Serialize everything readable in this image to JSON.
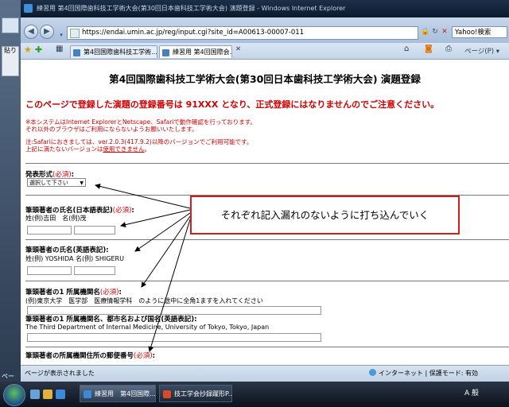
{
  "desktop": {
    "left_icon_label": "貼り",
    "bottom_label": "ペー"
  },
  "window": {
    "title": "練習用 第4回国際歯科技工学術大会(第30回日本歯科技工学術大会) 演題登録 - Windows Internet Explorer"
  },
  "address_bar": {
    "url": "https://endai.umin.ac.jp/reg/input.cgi?site_id=A00613-00007-011",
    "search_placeholder": "Yahoo!検索"
  },
  "tabs": [
    {
      "label": "第4回国際歯科技工学術..."
    },
    {
      "label": "練習用 第4回国際会..."
    }
  ],
  "toolbar": {
    "page_menu": "ページ(P)"
  },
  "page": {
    "heading": "第4回国際歯科技工学術大会(第30回日本歯科技工学術大会) 演題登録",
    "notice": "このページで登録した演題の登録番号は 91XXX となり、正式登録にはなりませんのでご注意ください。",
    "note1": "※本システムはInternet ExplorerとNetscape、Safariで動作確認を行っております。",
    "note2": "それ以外のブラウザはご利用にならないようお願いいたします。",
    "note3": "注:Safariにおきましては、ver.2.0.3(417.9.2)以降のバージョンでご利用可能です。",
    "note4_pre": "上記に満たないバージョンは",
    "note4_link": "使用できません",
    "note4_post": "。",
    "required": "(必須)",
    "field1_label": "発表形式",
    "field1_select": "選択して下さい",
    "field2_label": "筆頭著者の氏名(日本語表記)",
    "field2_example": "姓(例)吉田　名(例)茂",
    "field3_label": "筆頭著者の氏名(英語表記)",
    "field3_example": "姓(例) YOSHIDA 名(例) SHIGERU",
    "field4_label": "筆頭著者の1 所属機関名",
    "field4_example": "(例)東京大学　医学部　医療情報学科　のように途中に全角1ますを入れてください",
    "field5_label": "筆頭著者の1 所属機関名、都市名および国名(英語表記)",
    "field5_example": "The Third Department of Internal Medicine, University of Tokyo, Tokyo, Japan",
    "field6_label": "筆頭著者の所属機関住所の郵便番号",
    "colon": ":"
  },
  "callout": {
    "text": "それぞれ記入漏れのないように打ち込んでいく"
  },
  "status_bar": {
    "left": "ページが表示されました",
    "right": "インターネット | 保護モード: 有効"
  },
  "taskbar": {
    "tasks": [
      {
        "label": "練習用　第4回国際..."
      },
      {
        "label": "技工学会抄録躍形P..."
      }
    ],
    "tray_text": "A 般"
  }
}
